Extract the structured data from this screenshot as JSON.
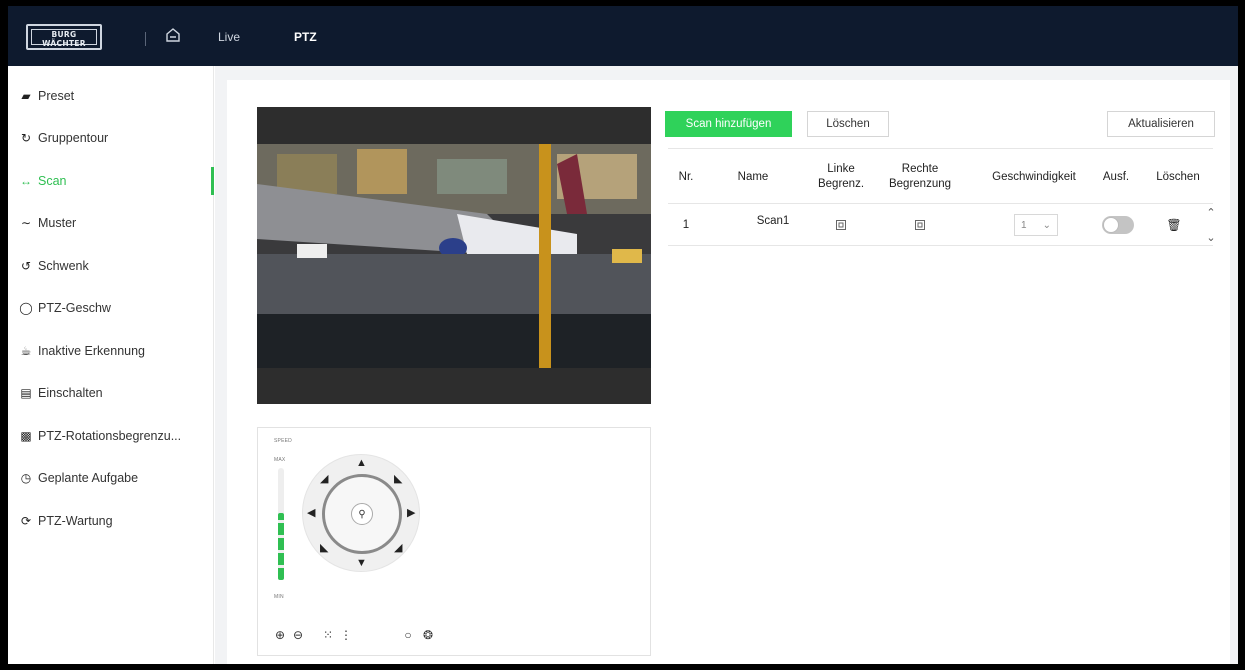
{
  "header": {
    "logo_line1": "BURG",
    "logo_line2": "WÄCHTER",
    "home_icon": "home-icon",
    "nav": [
      {
        "label": "Live",
        "active": false
      },
      {
        "label": "PTZ",
        "active": true
      }
    ],
    "background": "#0e1a2e"
  },
  "sidebar": {
    "items": [
      {
        "label": "Preset",
        "icon": "preset-icon",
        "active": false
      },
      {
        "label": "Gruppentour",
        "icon": "tour-icon",
        "active": false
      },
      {
        "label": "Scan",
        "icon": "scan-icon",
        "active": true
      },
      {
        "label": "Muster",
        "icon": "pattern-icon",
        "active": false
      },
      {
        "label": "Schwenk",
        "icon": "pan-icon",
        "active": false
      },
      {
        "label": "PTZ-Geschw",
        "icon": "speed-icon",
        "active": false
      },
      {
        "label": "Inaktive Erkennung",
        "icon": "idle-icon",
        "active": false
      },
      {
        "label": "Einschalten",
        "icon": "power-on-icon",
        "active": false
      },
      {
        "label": "PTZ-Rotationsbegrenzu...",
        "icon": "rotation-limit-icon",
        "active": false
      },
      {
        "label": "Geplante Aufgabe",
        "icon": "clock-icon",
        "active": false
      },
      {
        "label": "PTZ-Wartung",
        "icon": "maintenance-icon",
        "active": false
      }
    ],
    "accent": "#2fbf52"
  },
  "ptz": {
    "speed_label": "SPEED",
    "max_label": "MAX",
    "min_label": "MIN",
    "speed_level": 0.6
  },
  "toolbar": {
    "add_label": "Scan hinzufügen",
    "delete_label": "Löschen",
    "refresh_label": "Aktualisieren",
    "add_color": "#2fd25a"
  },
  "table": {
    "headers": {
      "nr": "Nr.",
      "name": "Name",
      "left": "Linke Begrenz.",
      "right": "Rechte Begrenzung",
      "speed": "Geschwindigkeit",
      "exec": "Ausf.",
      "delete": "Löschen"
    },
    "rows": [
      {
        "nr": "1",
        "name": "Scan1",
        "speed": "1",
        "enabled": false
      }
    ]
  }
}
